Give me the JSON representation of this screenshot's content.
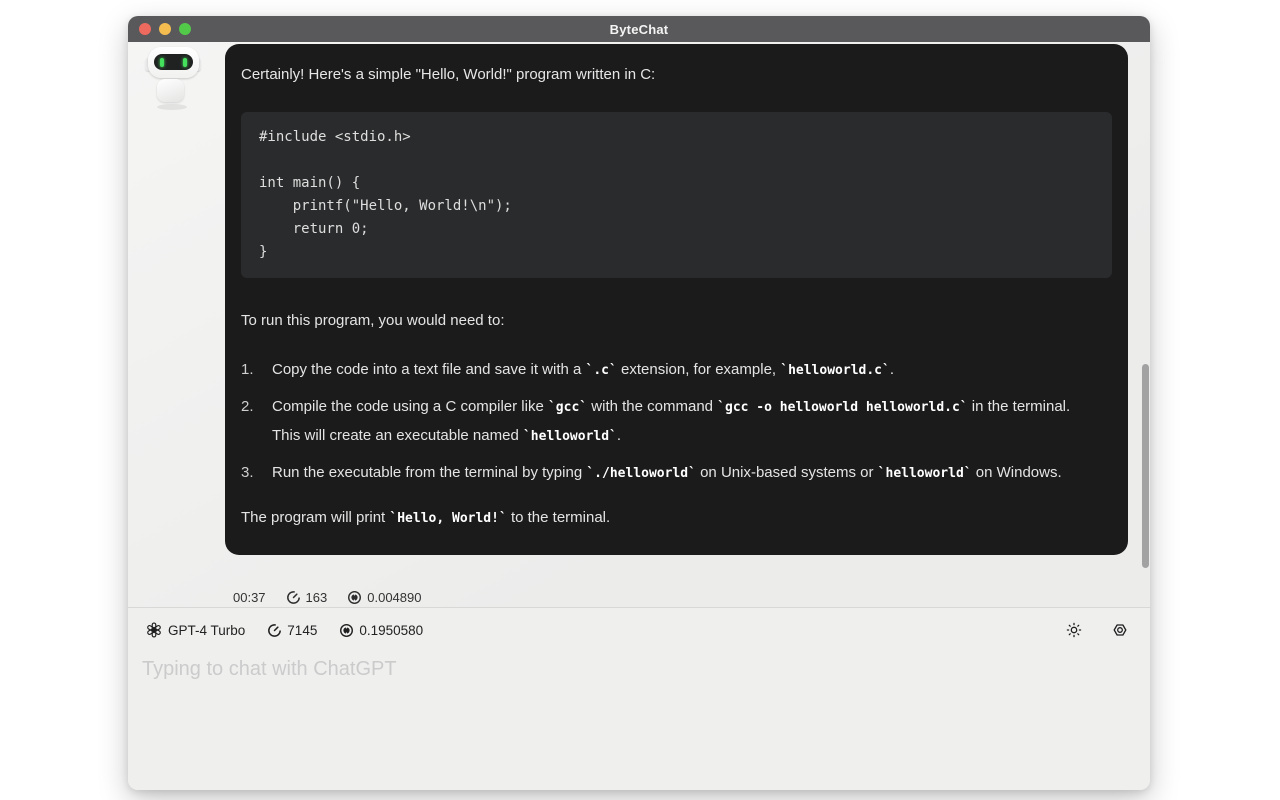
{
  "window": {
    "title": "ByteChat"
  },
  "chat": {
    "message": {
      "intro": "Certainly! Here's a simple \"Hello, World!\" program written in C:",
      "code": "#include <stdio.h>\n\nint main() {\n    printf(\"Hello, World!\\n\");\n    return 0;\n}",
      "steps_intro": "To run this program, you would need to:",
      "steps": [
        {
          "num": "1.",
          "segments": [
            {
              "t": "text",
              "v": "Copy the code into a text file and save it with a "
            },
            {
              "t": "code",
              "v": "`.c`"
            },
            {
              "t": "text",
              "v": " extension, for example, "
            },
            {
              "t": "code",
              "v": "`helloworld.c`"
            },
            {
              "t": "text",
              "v": "."
            }
          ]
        },
        {
          "num": "2.",
          "segments": [
            {
              "t": "text",
              "v": "Compile the code using a C compiler like "
            },
            {
              "t": "code",
              "v": "`gcc`"
            },
            {
              "t": "text",
              "v": " with the command "
            },
            {
              "t": "code",
              "v": "`gcc -o helloworld helloworld.c`"
            },
            {
              "t": "text",
              "v": " in the terminal. This will create an executable named "
            },
            {
              "t": "code",
              "v": "`helloworld`"
            },
            {
              "t": "text",
              "v": "."
            }
          ]
        },
        {
          "num": "3.",
          "segments": [
            {
              "t": "text",
              "v": "Run the executable from the terminal by typing "
            },
            {
              "t": "code",
              "v": "`./helloworld`"
            },
            {
              "t": "text",
              "v": " on Unix-based systems or "
            },
            {
              "t": "code",
              "v": "`helloworld`"
            },
            {
              "t": "text",
              "v": " on Windows."
            }
          ]
        }
      ],
      "outro_segments": [
        {
          "t": "text",
          "v": "The program will print "
        },
        {
          "t": "code",
          "v": "`Hello, World!`"
        },
        {
          "t": "text",
          "v": " to the terminal."
        }
      ]
    },
    "stats": {
      "time": "00:37",
      "tokens": "163",
      "cost": "0.004890"
    }
  },
  "composer": {
    "model": "GPT-4 Turbo",
    "session_tokens": "7145",
    "session_cost": "0.1950580",
    "placeholder": "Typing to chat with ChatGPT"
  },
  "colors": {
    "titlebar": "#59595b",
    "bubble": "#1b1b1c",
    "codeblock": "#2a2b2c",
    "window_bg": "#efefee",
    "eye_green": "#45e05c",
    "traffic_red": "#ee6a5f",
    "traffic_yellow": "#f5bd4f",
    "traffic_green": "#53c94a"
  }
}
